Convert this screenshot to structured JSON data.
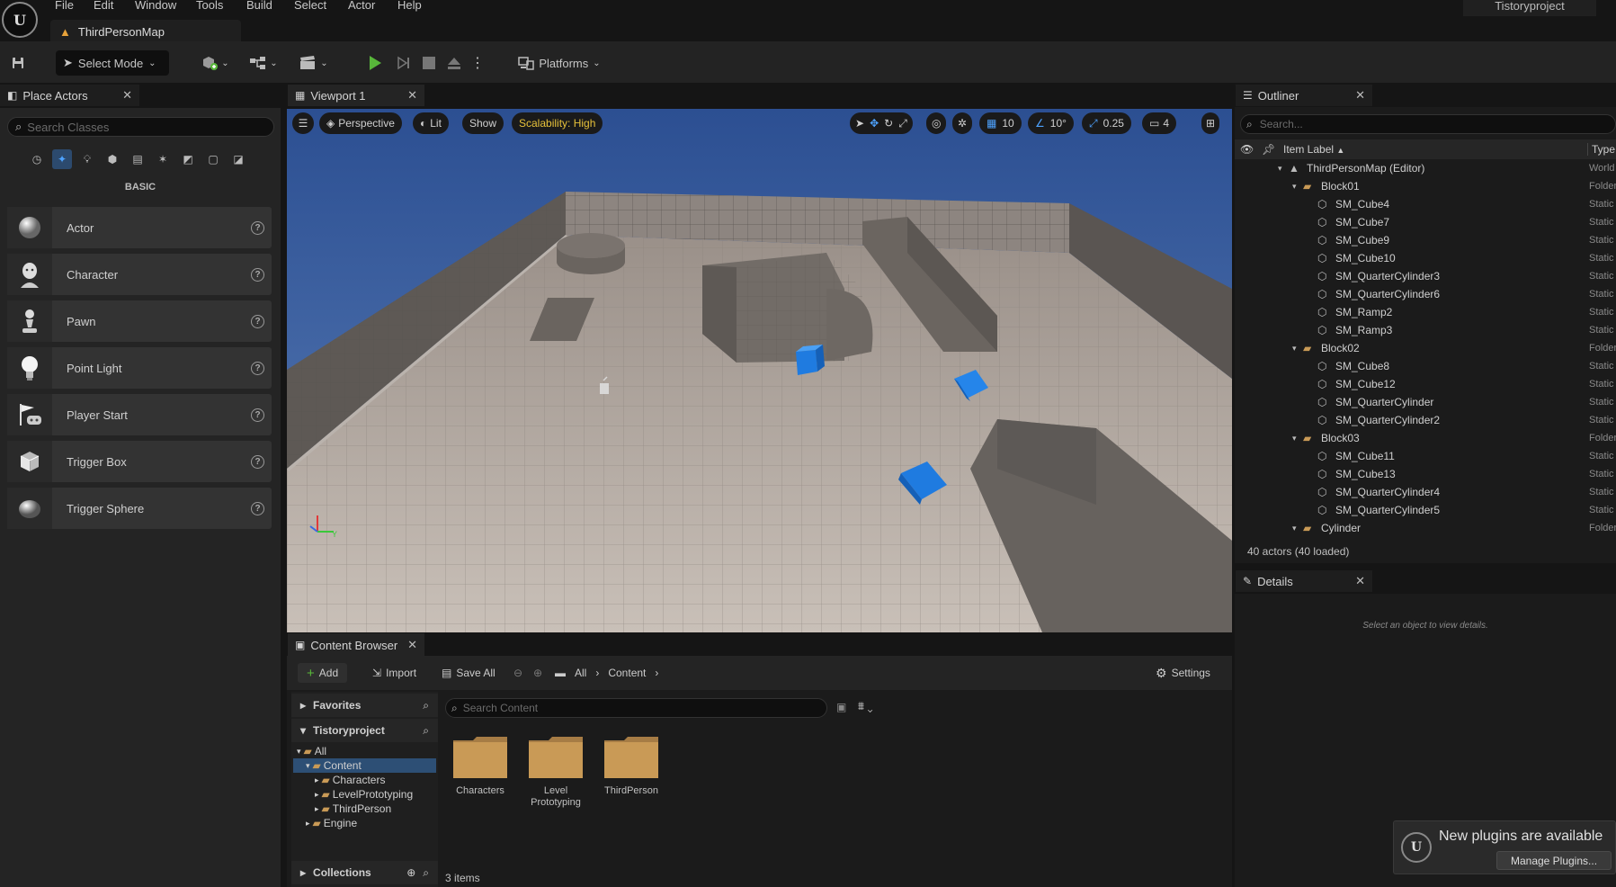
{
  "menu": [
    "File",
    "Edit",
    "Window",
    "Tools",
    "Build",
    "Select",
    "Actor",
    "Help"
  ],
  "map_tab": "ThirdPersonMap",
  "project_name": "Tistoryproject",
  "toolbar": {
    "select_mode": "Select Mode",
    "platforms": "Platforms"
  },
  "place_actors": {
    "tab_label": "Place Actors",
    "search_placeholder": "Search Classes",
    "category": "BASIC",
    "items": [
      {
        "label": "Actor",
        "icon": "sphere-icon"
      },
      {
        "label": "Character",
        "icon": "character-icon"
      },
      {
        "label": "Pawn",
        "icon": "pawn-icon"
      },
      {
        "label": "Point Light",
        "icon": "lightbulb-icon"
      },
      {
        "label": "Player Start",
        "icon": "player-start-icon"
      },
      {
        "label": "Trigger Box",
        "icon": "box-icon"
      },
      {
        "label": "Trigger Sphere",
        "icon": "sphere-icon"
      }
    ]
  },
  "viewport": {
    "tab_label": "Viewport 1",
    "perspective": "Perspective",
    "lit": "Lit",
    "show": "Show",
    "scalability": "Scalability: High",
    "grid_snap": "10",
    "rotation_snap": "10°",
    "scale_snap": "0.25",
    "camera_speed": "4"
  },
  "content_browser": {
    "tab_label": "Content Browser",
    "add": "Add",
    "import": "Import",
    "save_all": "Save All",
    "breadcrumb": [
      "All",
      "Content"
    ],
    "settings": "Settings",
    "favorites": "Favorites",
    "project": "Tistoryproject",
    "tree": [
      {
        "label": "All",
        "depth": 0
      },
      {
        "label": "Content",
        "depth": 1,
        "selected": true
      },
      {
        "label": "Characters",
        "depth": 2
      },
      {
        "label": "LevelPrototyping",
        "depth": 2
      },
      {
        "label": "ThirdPerson",
        "depth": 2
      },
      {
        "label": "Engine",
        "depth": 1
      }
    ],
    "collections": "Collections",
    "search_placeholder": "Search Content",
    "folders": [
      "Characters",
      "Level\nPrototyping",
      "ThirdPerson"
    ],
    "item_count": "3 items"
  },
  "outliner": {
    "tab_label": "Outliner",
    "search_placeholder": "Search...",
    "col_label": "Item Label",
    "col_type": "Type",
    "rows": [
      {
        "label": "ThirdPersonMap (Editor)",
        "depth": 0,
        "kind": "map",
        "type": "World"
      },
      {
        "label": "Block01",
        "depth": 1,
        "kind": "folder",
        "type": "Folder"
      },
      {
        "label": "SM_Cube4",
        "depth": 2,
        "kind": "mesh",
        "type": "Static"
      },
      {
        "label": "SM_Cube7",
        "depth": 2,
        "kind": "mesh",
        "type": "Static"
      },
      {
        "label": "SM_Cube9",
        "depth": 2,
        "kind": "mesh",
        "type": "Static"
      },
      {
        "label": "SM_Cube10",
        "depth": 2,
        "kind": "mesh",
        "type": "Static"
      },
      {
        "label": "SM_QuarterCylinder3",
        "depth": 2,
        "kind": "mesh",
        "type": "Static"
      },
      {
        "label": "SM_QuarterCylinder6",
        "depth": 2,
        "kind": "mesh",
        "type": "Static"
      },
      {
        "label": "SM_Ramp2",
        "depth": 2,
        "kind": "mesh",
        "type": "Static"
      },
      {
        "label": "SM_Ramp3",
        "depth": 2,
        "kind": "mesh",
        "type": "Static"
      },
      {
        "label": "Block02",
        "depth": 1,
        "kind": "folder",
        "type": "Folder"
      },
      {
        "label": "SM_Cube8",
        "depth": 2,
        "kind": "mesh",
        "type": "Static"
      },
      {
        "label": "SM_Cube12",
        "depth": 2,
        "kind": "mesh",
        "type": "Static"
      },
      {
        "label": "SM_QuarterCylinder",
        "depth": 2,
        "kind": "mesh",
        "type": "Static"
      },
      {
        "label": "SM_QuarterCylinder2",
        "depth": 2,
        "kind": "mesh",
        "type": "Static"
      },
      {
        "label": "Block03",
        "depth": 1,
        "kind": "folder",
        "type": "Folder"
      },
      {
        "label": "SM_Cube11",
        "depth": 2,
        "kind": "mesh",
        "type": "Static"
      },
      {
        "label": "SM_Cube13",
        "depth": 2,
        "kind": "mesh",
        "type": "Static"
      },
      {
        "label": "SM_QuarterCylinder4",
        "depth": 2,
        "kind": "mesh",
        "type": "Static"
      },
      {
        "label": "SM_QuarterCylinder5",
        "depth": 2,
        "kind": "mesh",
        "type": "Static"
      },
      {
        "label": "Cylinder",
        "depth": 1,
        "kind": "folder",
        "type": "Folder"
      }
    ],
    "actor_count": "40 actors (40 loaded)"
  },
  "details": {
    "tab_label": "Details",
    "empty_text": "Select an object to view details."
  },
  "notification": {
    "title": "New plugins are available",
    "button": "Manage Plugins..."
  },
  "colors": {
    "accent_blue": "#1e7de6",
    "play_green": "#58b73a",
    "sky": "#3a5d9b",
    "scalability": "#e6c13a",
    "folder": "#c99a56"
  }
}
